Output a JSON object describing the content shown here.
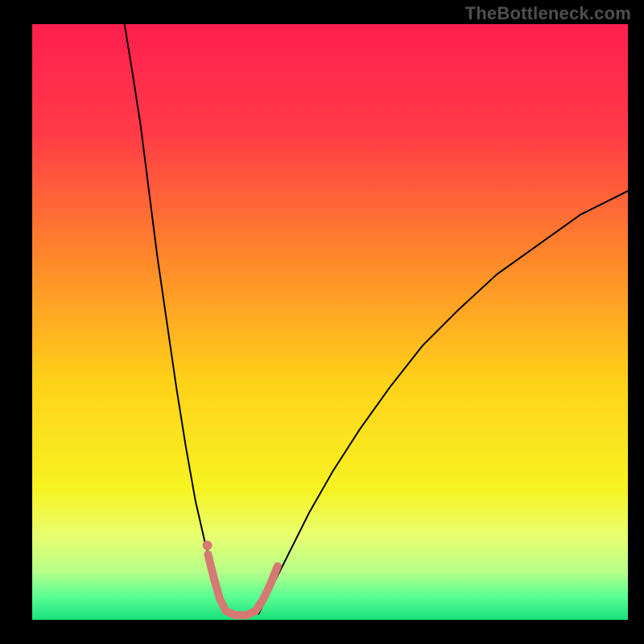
{
  "watermark": "TheBottleneck.com",
  "chart_data": {
    "type": "line",
    "title": "",
    "xlabel": "",
    "ylabel": "",
    "xlim": [
      0,
      100
    ],
    "ylim": [
      0,
      100
    ],
    "background_gradient_stops": [
      {
        "pct": 0,
        "color": "#ff1f4f"
      },
      {
        "pct": 18,
        "color": "#ff3a47"
      },
      {
        "pct": 40,
        "color": "#ff8a2a"
      },
      {
        "pct": 60,
        "color": "#ffd21a"
      },
      {
        "pct": 78,
        "color": "#f7f322"
      },
      {
        "pct": 86,
        "color": "#e8ff70"
      },
      {
        "pct": 92,
        "color": "#b6ff8a"
      },
      {
        "pct": 96,
        "color": "#5cff94"
      },
      {
        "pct": 100,
        "color": "#18e07a"
      }
    ],
    "series": [
      {
        "name": "left-branch",
        "stroke": "#000000",
        "stroke_width": 2,
        "points": [
          {
            "x": 15.5,
            "y": 100
          },
          {
            "x": 16.8,
            "y": 92
          },
          {
            "x": 18.2,
            "y": 83
          },
          {
            "x": 19.6,
            "y": 72
          },
          {
            "x": 21.0,
            "y": 61
          },
          {
            "x": 22.6,
            "y": 50
          },
          {
            "x": 24.2,
            "y": 39
          },
          {
            "x": 25.8,
            "y": 29
          },
          {
            "x": 27.4,
            "y": 20
          },
          {
            "x": 29.0,
            "y": 13
          },
          {
            "x": 30.3,
            "y": 8
          },
          {
            "x": 31.3,
            "y": 4
          },
          {
            "x": 32.0,
            "y": 2
          },
          {
            "x": 32.5,
            "y": 1
          }
        ]
      },
      {
        "name": "right-branch",
        "stroke": "#000000",
        "stroke_width": 2,
        "points": [
          {
            "x": 38.0,
            "y": 1
          },
          {
            "x": 39.0,
            "y": 3
          },
          {
            "x": 40.5,
            "y": 6
          },
          {
            "x": 43.0,
            "y": 11
          },
          {
            "x": 46.5,
            "y": 18
          },
          {
            "x": 50.5,
            "y": 25
          },
          {
            "x": 55.0,
            "y": 32
          },
          {
            "x": 60.0,
            "y": 39
          },
          {
            "x": 65.5,
            "y": 46
          },
          {
            "x": 71.5,
            "y": 52
          },
          {
            "x": 78.0,
            "y": 58
          },
          {
            "x": 85.0,
            "y": 63
          },
          {
            "x": 92.0,
            "y": 68
          },
          {
            "x": 100.0,
            "y": 72
          }
        ]
      },
      {
        "name": "highlight-segment",
        "stroke": "#d57a73",
        "stroke_width": 10,
        "points": [
          {
            "x": 29.5,
            "y": 11.0
          },
          {
            "x": 30.5,
            "y": 7.0
          },
          {
            "x": 31.5,
            "y": 3.5
          },
          {
            "x": 32.5,
            "y": 1.5
          },
          {
            "x": 34.0,
            "y": 0.8
          },
          {
            "x": 36.0,
            "y": 0.8
          },
          {
            "x": 37.5,
            "y": 1.5
          },
          {
            "x": 38.8,
            "y": 3.5
          },
          {
            "x": 40.0,
            "y": 6.0
          },
          {
            "x": 41.2,
            "y": 9.0
          }
        ]
      },
      {
        "name": "highlight-dot",
        "stroke": "#d57a73",
        "stroke_width": 0,
        "is_point": true,
        "radius": 6,
        "points": [
          {
            "x": 29.4,
            "y": 12.5
          }
        ]
      }
    ]
  }
}
